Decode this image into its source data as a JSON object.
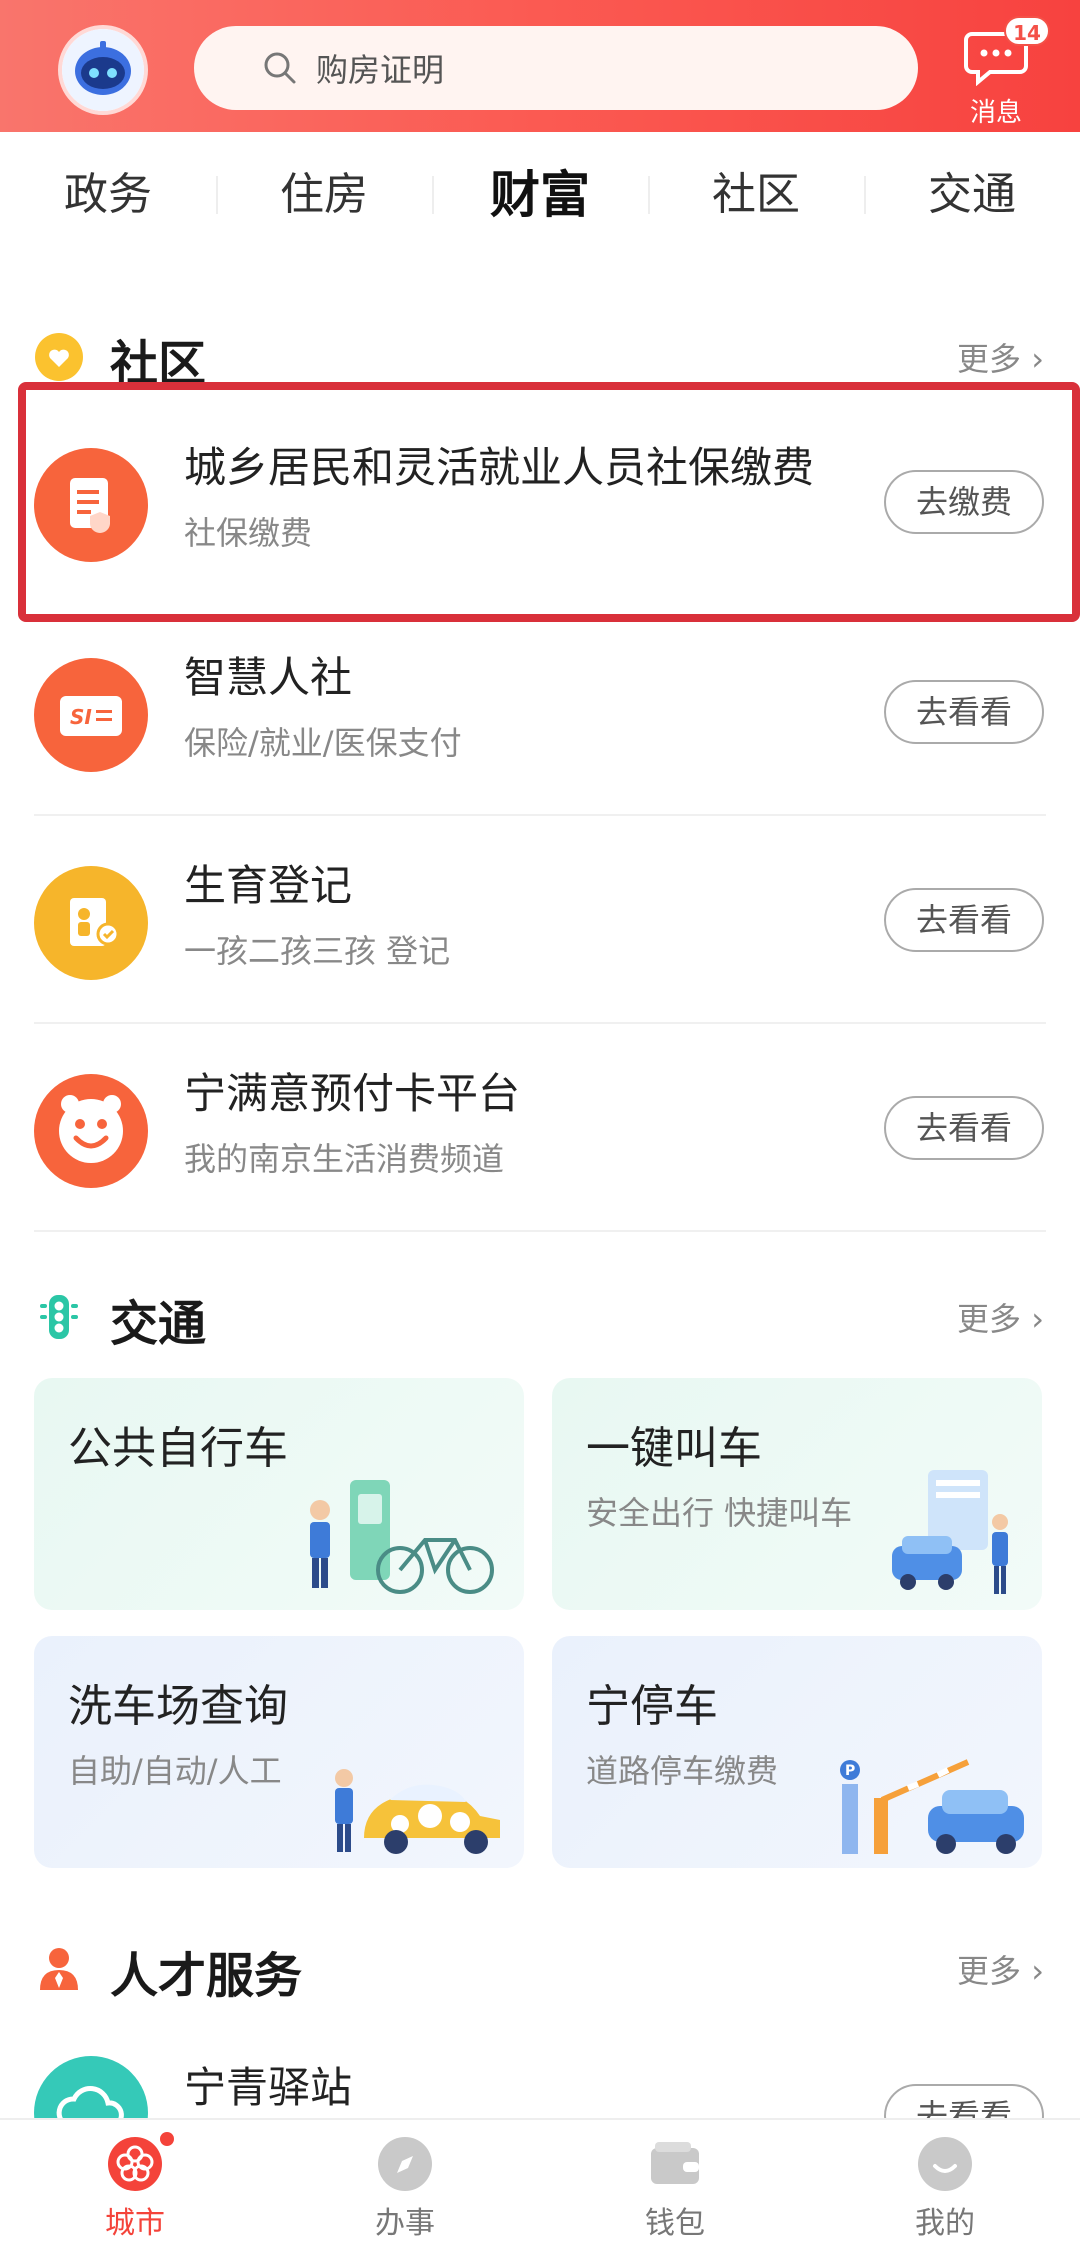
{
  "header": {
    "search_placeholder": "购房证明",
    "message_label": "消息",
    "message_badge": "14"
  },
  "tabs": [
    {
      "label": "政务",
      "active": false
    },
    {
      "label": "住房",
      "active": false
    },
    {
      "label": "财富",
      "active": true
    },
    {
      "label": "社区",
      "active": false
    },
    {
      "label": "交通",
      "active": false
    }
  ],
  "community": {
    "title": "社区",
    "more": "更多",
    "items": [
      {
        "title": "城乡居民和灵活就业人员社保缴费",
        "subtitle": "社保缴费",
        "button": "去缴费",
        "icon": "document-shield-icon",
        "color": "#f7643c"
      },
      {
        "title": "智慧人社",
        "subtitle": "保险/就业/医保支付",
        "button": "去看看",
        "icon": "si-card-icon",
        "color": "#f7643c"
      },
      {
        "title": "生育登记",
        "subtitle": "一孩二孩三孩 登记",
        "button": "去看看",
        "icon": "birth-register-icon",
        "color": "#f6b52b"
      },
      {
        "title": "宁满意预付卡平台",
        "subtitle": "我的南京生活消费频道",
        "button": "去看看",
        "icon": "smile-icon",
        "color": "#f7643c"
      }
    ]
  },
  "traffic": {
    "title": "交通",
    "more": "更多",
    "cards": [
      {
        "title": "公共自行车",
        "subtitle": ""
      },
      {
        "title": "一键叫车",
        "subtitle": "安全出行 快捷叫车"
      },
      {
        "title": "洗车场查询",
        "subtitle": "自助/自动/人工"
      },
      {
        "title": "宁停车",
        "subtitle": "道路停车缴费"
      }
    ]
  },
  "talent": {
    "title": "人才服务",
    "more": "更多",
    "items": [
      {
        "title": "宁青驿站",
        "button": "去看看"
      }
    ]
  },
  "bottom_nav": [
    {
      "label": "城市",
      "active": true
    },
    {
      "label": "办事",
      "active": false
    },
    {
      "label": "钱包",
      "active": false
    },
    {
      "label": "我的",
      "active": false
    }
  ]
}
